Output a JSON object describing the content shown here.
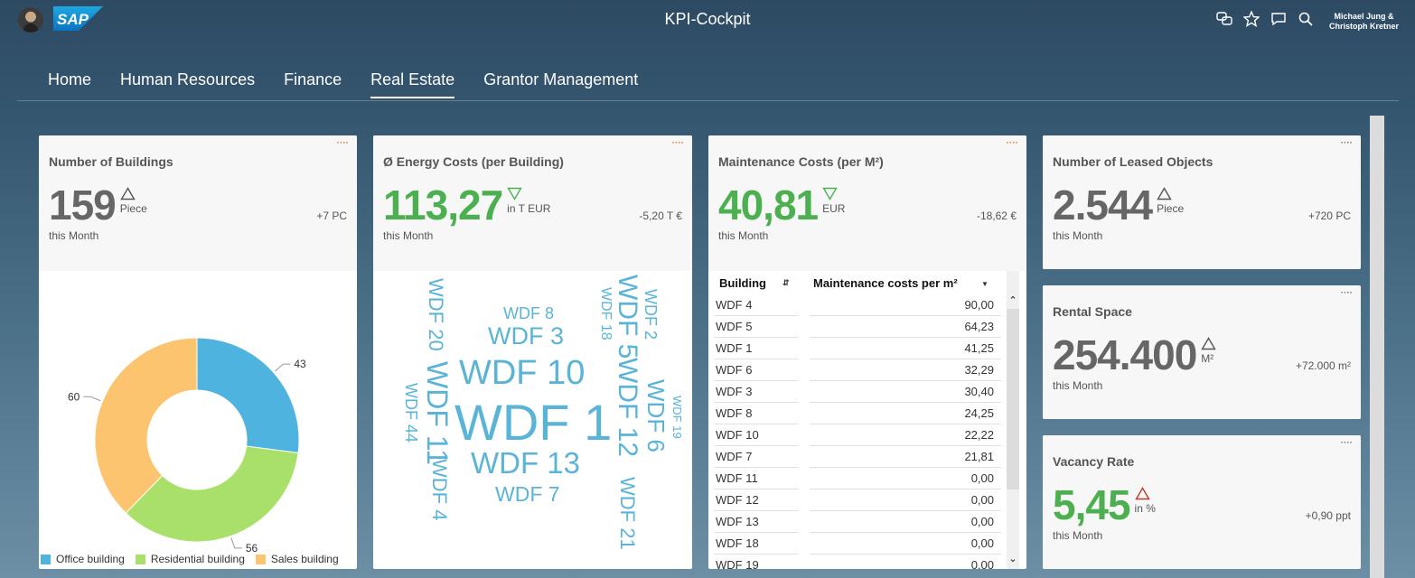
{
  "shell": {
    "title": "KPI-Cockpit",
    "user_line1": "Michael Jung &",
    "user_line2": "Christoph Kretner",
    "icons": [
      "chat-icon",
      "star-icon",
      "feedback-icon",
      "search-icon"
    ]
  },
  "tabs": [
    {
      "label": "Home",
      "active": false
    },
    {
      "label": "Human Resources",
      "active": false
    },
    {
      "label": "Finance",
      "active": false
    },
    {
      "label": "Real Estate",
      "active": true
    },
    {
      "label": "Grantor Management",
      "active": false
    }
  ],
  "colors": {
    "good": "#4caf50",
    "neutral": "#666666",
    "bad_indicator": "#c0392b",
    "office": "#4fb3e0",
    "residential": "#a8e06a",
    "sales": "#fcc46e",
    "cloud": "#5ab4d8"
  },
  "cards": {
    "buildings": {
      "title": "Number of Buildings",
      "value": "159",
      "unit": "Piece",
      "delta": "+7 PC",
      "period": "this Month",
      "trend": "up"
    },
    "energy": {
      "title": "Ø Energy Costs (per Building)",
      "value": "113,27",
      "unit": "in T EUR",
      "delta": "-5,20 T €",
      "period": "this Month",
      "trend": "down"
    },
    "maintenance": {
      "title": "Maintenance Costs (per M²)",
      "value": "40,81",
      "unit": "EUR",
      "delta": "-18,62 €",
      "period": "this Month",
      "trend": "down"
    },
    "leased": {
      "title": "Number of Leased Objects",
      "value": "2.544",
      "unit": "Piece",
      "delta": "+720 PC",
      "period": "this Month",
      "trend": "up"
    },
    "rental": {
      "title": "Rental Space",
      "value": "254.400",
      "unit": "M²",
      "delta": "+72.000 m²",
      "period": "this Month",
      "trend": "up"
    },
    "vacancy": {
      "title": "Vacancy Rate",
      "value": "5,45",
      "unit": "in %",
      "delta": "+0,90 ppt",
      "period": "this Month",
      "trend": "up-bad"
    }
  },
  "chart_data": {
    "type": "pie",
    "donut": true,
    "categories": [
      "Office building",
      "Residential building",
      "Sales building"
    ],
    "values": [
      43,
      56,
      60
    ],
    "legend": "bottom"
  },
  "word_cloud": {
    "words": [
      "WDF 1",
      "WDF 10",
      "WDF 13",
      "WDF 3",
      "WDF 8",
      "WDF 7",
      "WDF 20",
      "WDF 11",
      "WDF 4",
      "WDF 44",
      "WDF 5",
      "WDF 18",
      "WDF 2",
      "WDF 12",
      "WDF 6",
      "WDF 19",
      "WDF 21"
    ]
  },
  "table": {
    "col_building": "Building",
    "col_cost": "Maintenance costs per m²",
    "rows": [
      {
        "building": "WDF 4",
        "cost": "90,00"
      },
      {
        "building": "WDF 5",
        "cost": "64,23"
      },
      {
        "building": "WDF 1",
        "cost": "41,25"
      },
      {
        "building": "WDF 6",
        "cost": "32,29"
      },
      {
        "building": "WDF 3",
        "cost": "30,40"
      },
      {
        "building": "WDF 8",
        "cost": "24,25"
      },
      {
        "building": "WDF 10",
        "cost": "22,22"
      },
      {
        "building": "WDF 7",
        "cost": "21,81"
      },
      {
        "building": "WDF 11",
        "cost": "0,00"
      },
      {
        "building": "WDF 12",
        "cost": "0,00"
      },
      {
        "building": "WDF 13",
        "cost": "0,00"
      },
      {
        "building": "WDF 18",
        "cost": "0,00"
      },
      {
        "building": "WDF 19",
        "cost": "0,00"
      }
    ]
  }
}
